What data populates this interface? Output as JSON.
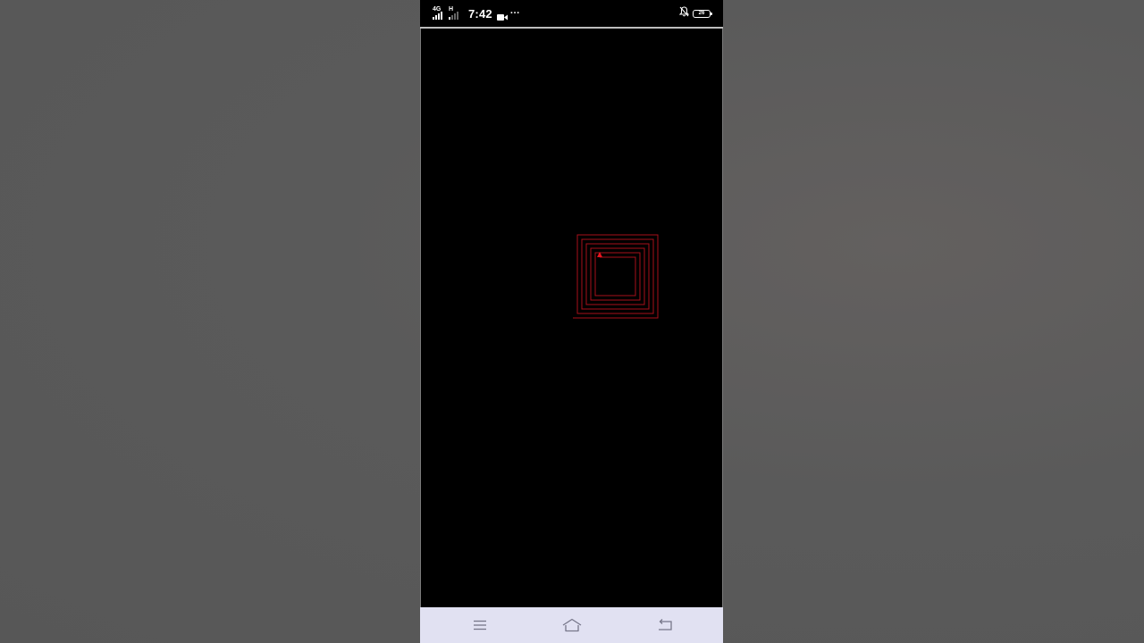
{
  "status_bar": {
    "network_1": "4G",
    "network_2": "H",
    "time": "7:42",
    "more_indicator": "···",
    "battery_level": "26",
    "icons": [
      "signal-icon",
      "signal-icon",
      "video-camera-icon",
      "more-dots-icon",
      "notifications-muted-icon",
      "battery-icon"
    ]
  },
  "canvas": {
    "description_icon": "spiral-drawing",
    "stroke_color": "#b3121b",
    "cursor_color": "#e8141f",
    "background_color": "#000000"
  },
  "nav_bar": {
    "buttons": [
      {
        "name": "menu-button",
        "icon": "hamburger-icon"
      },
      {
        "name": "home-button",
        "icon": "home-icon"
      },
      {
        "name": "back-button",
        "icon": "back-icon"
      }
    ],
    "background_color": "#e1e1f2"
  }
}
